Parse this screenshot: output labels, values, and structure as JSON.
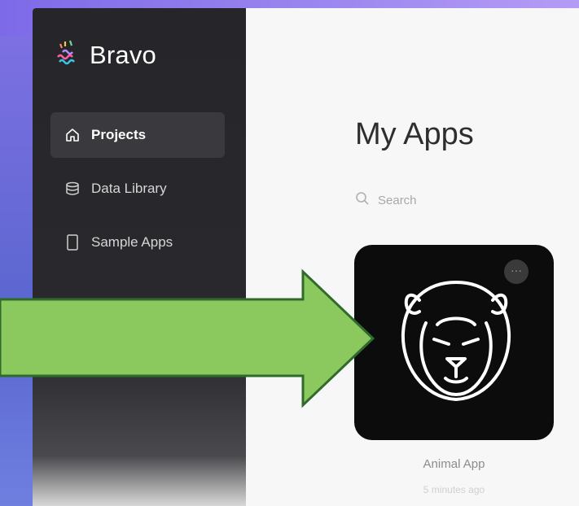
{
  "brand": {
    "name": "Bravo"
  },
  "sidebar": {
    "items": [
      {
        "label": "Projects",
        "icon": "home-icon",
        "active": true
      },
      {
        "label": "Data Library",
        "icon": "database-icon",
        "active": false
      },
      {
        "label": "Sample Apps",
        "icon": "phone-icon",
        "active": false
      }
    ]
  },
  "main": {
    "title": "My Apps",
    "search": {
      "placeholder": "Search"
    },
    "apps": [
      {
        "name": "Animal App",
        "time": "5 minutes ago",
        "icon": "lion-icon"
      }
    ]
  },
  "overlay": {
    "arrow_color": "#8bc95f",
    "icon": "right-arrow-icon"
  },
  "colors": {
    "sidebar": "#26262a",
    "main_bg": "#f7f7f7",
    "card_bg": "#0c0c0c"
  }
}
